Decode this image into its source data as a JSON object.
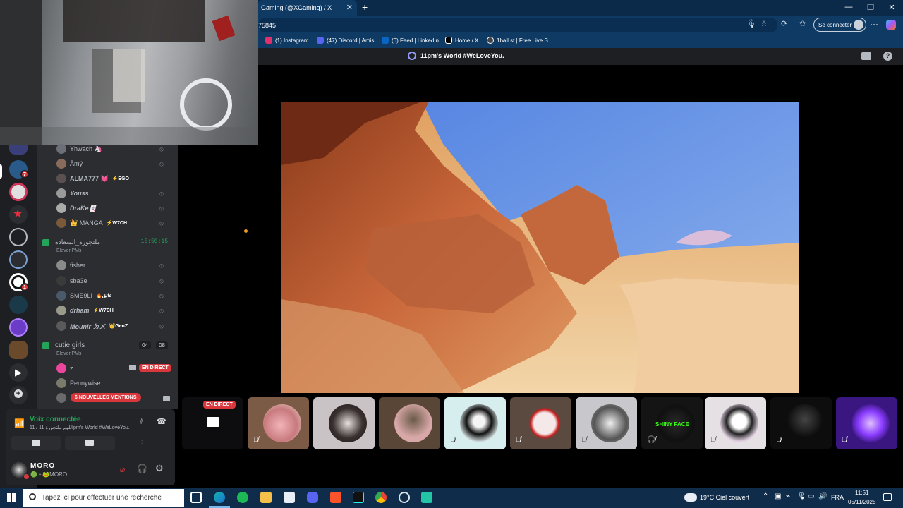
{
  "browser": {
    "tab_title": "Gaming (@XGaming) / X",
    "tab_close": "✕",
    "new_tab": "+",
    "address_fragment": "75845",
    "signin_label": "Se connecter",
    "more": "···",
    "minimize": "—",
    "maximize": "❐",
    "close": "✕"
  },
  "favorites": [
    {
      "label": "(1) Instagram",
      "color": "#e1306c"
    },
    {
      "label": "(47) Discord | Amis",
      "color": "#5865f2"
    },
    {
      "label": "(6) Feed | LinkedIn",
      "color": "#0a66c2"
    },
    {
      "label": "Home / X",
      "color": "#000000"
    },
    {
      "label": "1ball.st | Free Live S...",
      "color": "#444444"
    }
  ],
  "stage": {
    "title": "11pm's World #WeLoveYou.",
    "help": "?"
  },
  "members_top": [
    {
      "name": "Yhwach 🦄",
      "tag": ""
    },
    {
      "name": "Āmÿ",
      "tag": ""
    },
    {
      "name": "ALMA777 💓",
      "tag": "⚡EGO"
    },
    {
      "name": "Youss",
      "tag": ""
    },
    {
      "name": "DraKe🃏",
      "tag": ""
    },
    {
      "name": "👑 MANGA",
      "tag": "⚡W7CH"
    }
  ],
  "channel1": {
    "name": "ملتجورة_السعادة",
    "sub": "ElevenPMs",
    "timer": "15:50:15"
  },
  "members_mid": [
    {
      "name": "fisher",
      "tag": ""
    },
    {
      "name": "sba3e",
      "tag": ""
    },
    {
      "name": "SME9LI",
      "tag": "🔥عائق"
    },
    {
      "name": "drham",
      "tag": "⚡W7CH"
    },
    {
      "name": "Mounir ㄉㄨ",
      "tag": "👑GenZ"
    }
  ],
  "channel2": {
    "name": "cutie girls",
    "sub": "ElevenPMs",
    "count_left": "04",
    "count_right": "08"
  },
  "members_bottom": [
    {
      "name": "z",
      "tag": "EN DIRECT"
    },
    {
      "name": "Pennywise",
      "tag": ""
    }
  ],
  "mentions_pill": "6 NOUVELLES MENTIONS",
  "voice": {
    "status": "Voix connectée",
    "channel": "11 / اللهم ملتجورة 11pm's World #WeLoveYou."
  },
  "user": {
    "name": "MORO",
    "sub": "🟢 • 🐸MORO"
  },
  "stage_tiles": {
    "live_label": "EN DIRECT",
    "tile_texts": [
      "",
      "",
      "",
      "",
      "",
      "",
      "",
      "SHINY FACE",
      "",
      "",
      ""
    ]
  },
  "taskbar": {
    "search_placeholder": "Tapez ici pour effectuer une recherche",
    "weather": "19°C  Ciel couvert",
    "lang": "FRA",
    "time": "11:51",
    "date": "05/11/2025"
  },
  "server_badges": [
    "7",
    "1"
  ]
}
